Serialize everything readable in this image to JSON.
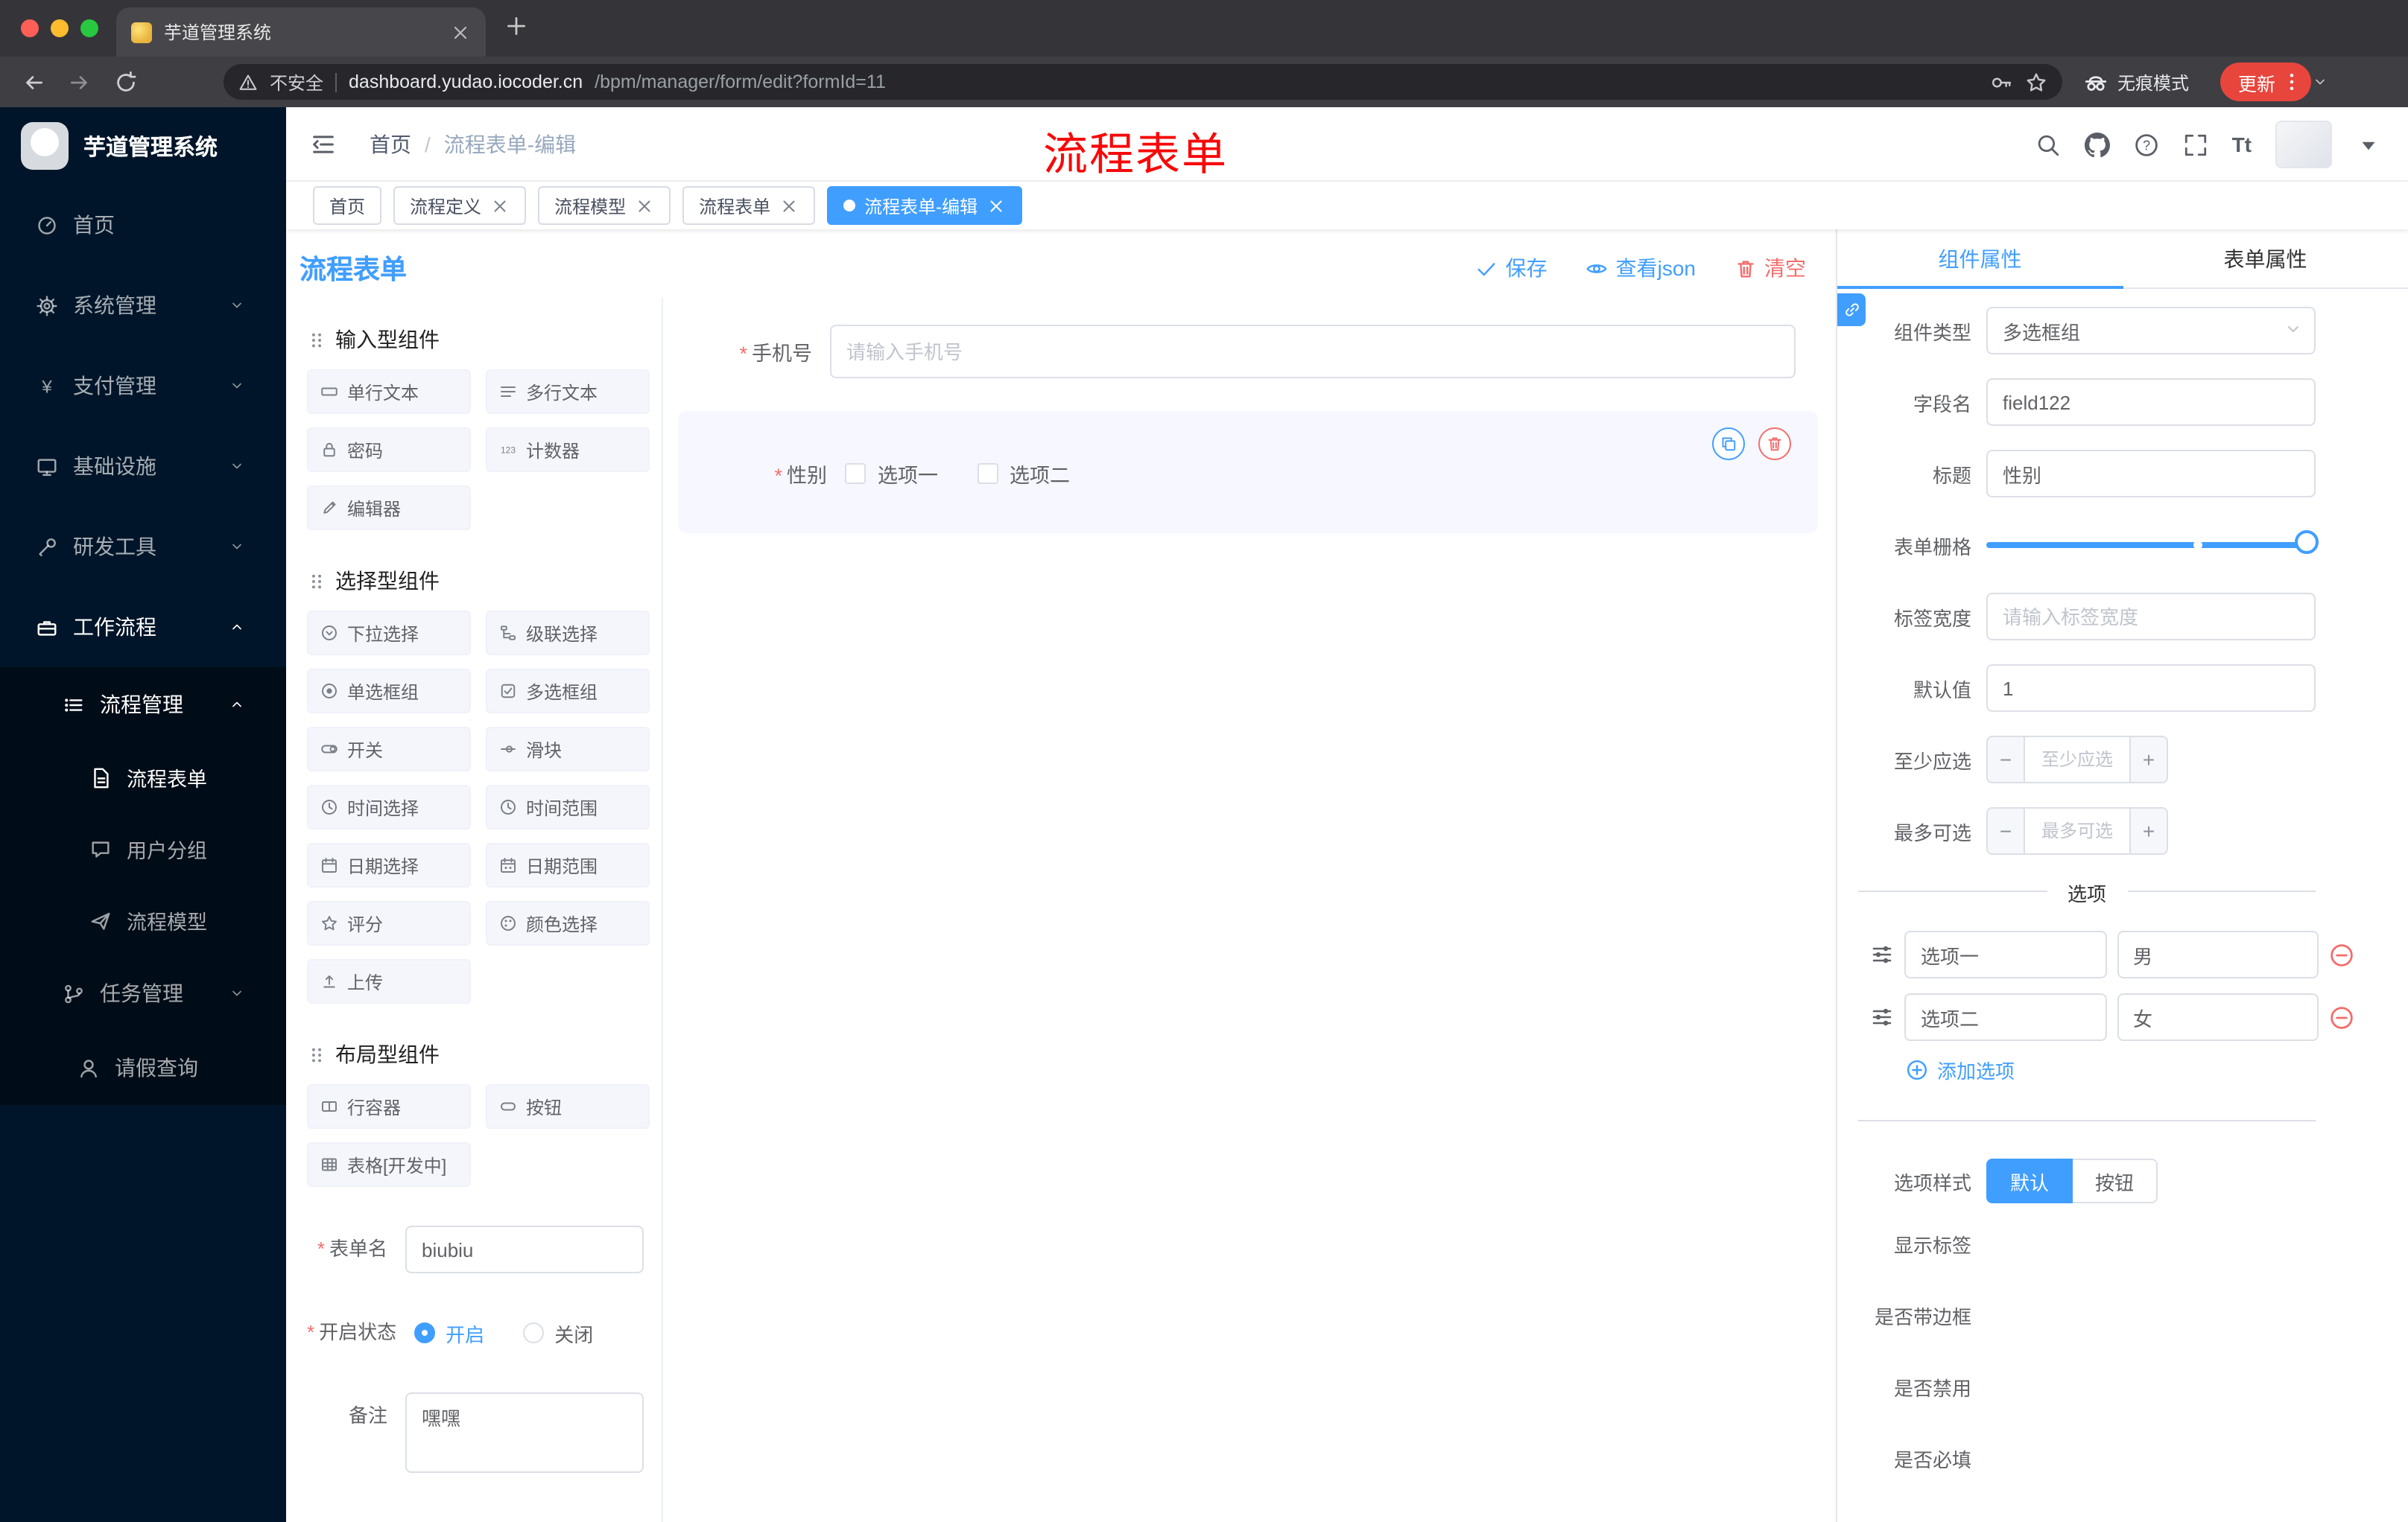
{
  "colors": {
    "primary": "#409eff",
    "danger": "#f56c6c",
    "annotation_red": "#f70909",
    "sidebar_bg": "#001529",
    "sidebar_sub_bg": "#000c17",
    "active_tag_bg": "#409eff"
  },
  "browser": {
    "tab_title": "芋道管理系统",
    "security_label": "不安全",
    "url_domain": "dashboard.yudao.iocoder.cn",
    "url_path": "/bpm/manager/form/edit?formId=11",
    "incognito_label": "无痕模式",
    "update_label": "更新",
    "icons": [
      "back-icon",
      "forward-icon",
      "reload-icon",
      "warning-icon",
      "key-icon",
      "bookmark-star-icon",
      "incognito-icon",
      "more-dots-icon",
      "chevron-down-icon"
    ]
  },
  "sidebar": {
    "app_title": "芋道管理系统",
    "menu": [
      {
        "label": "首页",
        "icon": "dashboard-icon"
      },
      {
        "label": "系统管理",
        "icon": "gear-icon",
        "arrow": "down"
      },
      {
        "label": "支付管理",
        "icon": "yen-icon",
        "arrow": "down"
      },
      {
        "label": "基础设施",
        "icon": "monitor-icon",
        "arrow": "down"
      },
      {
        "label": "研发工具",
        "icon": "wrench-icon",
        "arrow": "down"
      },
      {
        "label": "工作流程",
        "icon": "briefcase-icon",
        "arrow": "up"
      }
    ],
    "submenu": {
      "label": "流程管理",
      "icon": "list-icon",
      "arrow": "up",
      "items": [
        {
          "label": "流程表单",
          "icon": "document-icon",
          "active": true
        },
        {
          "label": "用户分组",
          "icon": "chat-icon"
        },
        {
          "label": "流程模型",
          "icon": "paper-plane-icon"
        }
      ]
    },
    "menu_tail": [
      {
        "label": "任务管理",
        "icon": "branch-icon",
        "arrow": "down"
      },
      {
        "label": "请假查询",
        "icon": "user-icon"
      }
    ]
  },
  "header": {
    "breadcrumb": [
      "首页",
      "流程表单-编辑"
    ],
    "annotation": "流程表单",
    "font_icon": "Tt",
    "icons": [
      "collapse-menu-icon",
      "search-icon",
      "github-icon",
      "question-icon",
      "fullscreen-icon",
      "font-size-icon",
      "avatar"
    ]
  },
  "tags": [
    {
      "label": "首页",
      "closable": false,
      "active": false
    },
    {
      "label": "流程定义",
      "closable": true,
      "active": false
    },
    {
      "label": "流程模型",
      "closable": true,
      "active": false
    },
    {
      "label": "流程表单",
      "closable": true,
      "active": false
    },
    {
      "label": "流程表单-编辑",
      "closable": true,
      "active": true
    }
  ],
  "designer": {
    "title": "流程表单",
    "actions": {
      "save": "保存",
      "view_json": "查看json",
      "clear": "清空"
    },
    "left_sections": [
      {
        "title": "输入型组件",
        "icon": "drag-grip-icon",
        "items": [
          {
            "label": "单行文本",
            "icon": "single-line-text-icon"
          },
          {
            "label": "多行文本",
            "icon": "textarea-icon"
          },
          {
            "label": "密码",
            "icon": "password-icon"
          },
          {
            "label": "计数器",
            "icon": "counter-icon"
          },
          {
            "label": "编辑器",
            "icon": "editor-icon"
          }
        ]
      },
      {
        "title": "选择型组件",
        "icon": "drag-grip-icon",
        "items": [
          {
            "label": "下拉选择",
            "icon": "select-icon"
          },
          {
            "label": "级联选择",
            "icon": "cascader-icon"
          },
          {
            "label": "单选框组",
            "icon": "radio-group-icon"
          },
          {
            "label": "多选框组",
            "icon": "checkbox-group-icon"
          },
          {
            "label": "开关",
            "icon": "switch-icon"
          },
          {
            "label": "滑块",
            "icon": "slider-icon"
          },
          {
            "label": "时间选择",
            "icon": "time-picker-icon"
          },
          {
            "label": "时间范围",
            "icon": "time-range-icon"
          },
          {
            "label": "日期选择",
            "icon": "date-picker-icon"
          },
          {
            "label": "日期范围",
            "icon": "date-range-icon"
          },
          {
            "label": "评分",
            "icon": "rate-icon"
          },
          {
            "label": "颜色选择",
            "icon": "color-picker-icon"
          },
          {
            "label": "上传",
            "icon": "upload-icon"
          }
        ]
      },
      {
        "title": "布局型组件",
        "icon": "drag-grip-icon",
        "items": [
          {
            "label": "行容器",
            "icon": "row-container-icon"
          },
          {
            "label": "按钮",
            "icon": "button-icon"
          },
          {
            "label": "表格[开发中]",
            "icon": "table-icon"
          }
        ]
      }
    ],
    "meta": {
      "form_name_label": "表单名",
      "form_name_value": "biubiu",
      "status_label": "开启状态",
      "status_on": "开启",
      "status_off": "关闭",
      "status_selected": "开启",
      "remark_label": "备注",
      "remark_value": "嘿嘿"
    },
    "canvas": {
      "phone_label": "手机号",
      "phone_placeholder": "请输入手机号",
      "gender_label": "性别",
      "option1": "选项一",
      "option2": "选项二"
    }
  },
  "inspector": {
    "tab_component": "组件属性",
    "tab_form": "表单属性",
    "active_tab": "组件属性",
    "component_type_label": "组件类型",
    "component_type_value": "多选框组",
    "field_label": "字段名",
    "field_value": "field122",
    "title_label": "标题",
    "title_value": "性别",
    "grid_label": "表单栅格",
    "label_width_label": "标签宽度",
    "label_width_placeholder": "请输入标签宽度",
    "default_label": "默认值",
    "default_value": "1",
    "min_label": "至少应选",
    "min_placeholder": "至少应选",
    "max_label": "最多可选",
    "max_placeholder": "最多可选",
    "options_title": "选项",
    "options": [
      {
        "label": "选项一",
        "value": "男"
      },
      {
        "label": "选项二",
        "value": "女"
      }
    ],
    "add_option": "添加选项",
    "style_label": "选项样式",
    "style_default": "默认",
    "style_button": "按钮",
    "style_selected": "默认",
    "switches": [
      {
        "label": "显示标签",
        "on": true
      },
      {
        "label": "是否带边框",
        "on": false
      },
      {
        "label": "是否禁用",
        "on": false
      },
      {
        "label": "是否必填",
        "on": true
      }
    ]
  }
}
